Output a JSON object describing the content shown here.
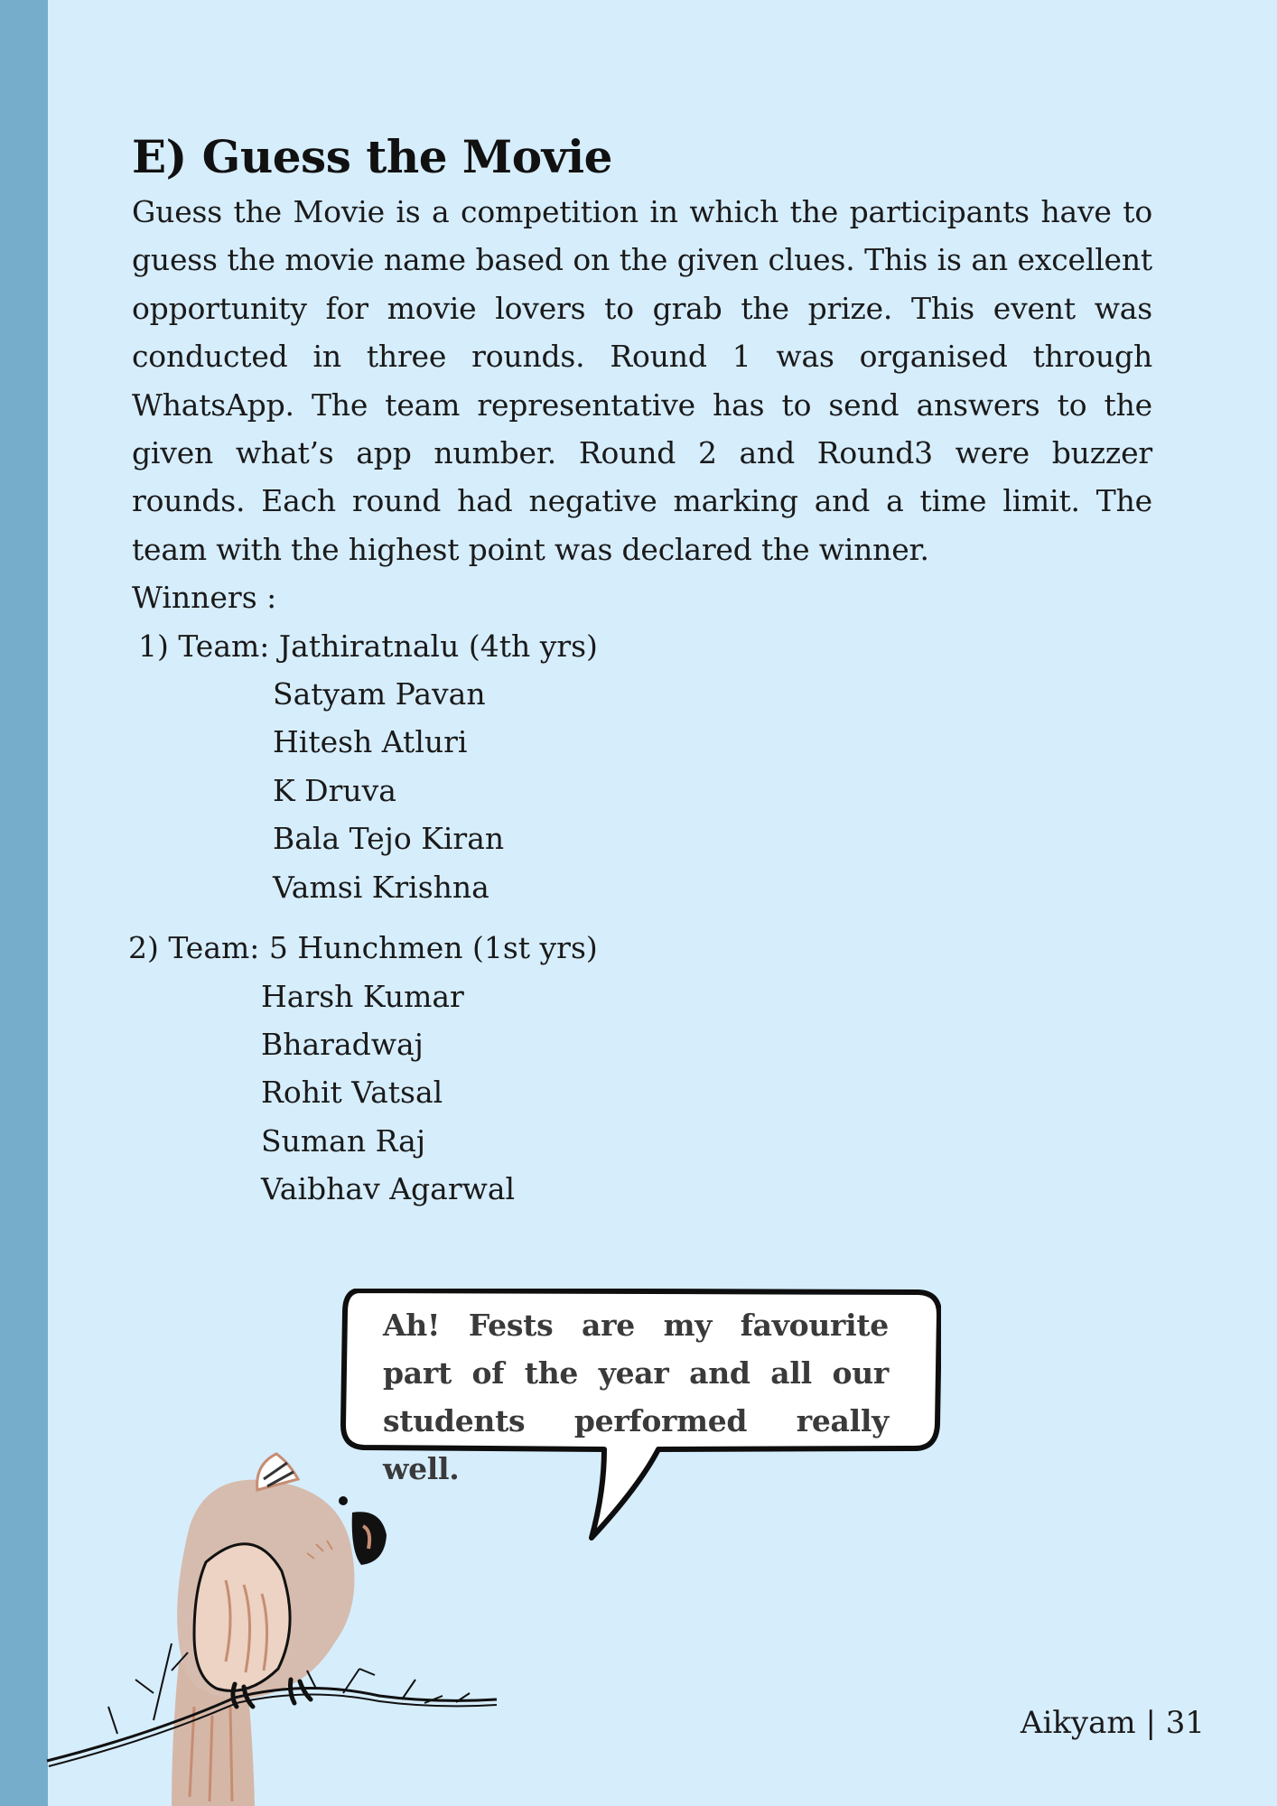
{
  "section": {
    "title": "E) Guess the Movie",
    "body": "Guess the Movie is a competition in which the participants have to guess the movie name based on the given clues. This is an excellent opportunity for movie lovers to grab the prize. This event was conducted in three rounds. Round 1 was organised through WhatsApp. The team representative has to send answers to the given what’s app number. Round 2 and Round3 were buzzer rounds. Each round had negative marking and a time limit. The team with the highest point was declared the winner.",
    "winners_label": "Winners :"
  },
  "teams": [
    {
      "heading": "1) Team: Jathiratnalu (4th yrs)",
      "members": [
        "Satyam Pavan",
        "Hitesh Atluri",
        "K Druva",
        "Bala Tejo Kiran",
        "Vamsi Krishna"
      ]
    },
    {
      "heading": "2) Team: 5 Hunchmen (1st yrs)",
      "members": [
        "Harsh Kumar",
        "Bharadwaj",
        "Rohit Vatsal",
        "Suman Raj",
        "Vaibhav Agarwal"
      ]
    }
  ],
  "speech_bubble": {
    "text": "Ah! Fests are my favourite part of the year and all our students performed really well."
  },
  "footer": {
    "magazine": "Aikyam",
    "separator": "|",
    "page_number": "31"
  },
  "colors": {
    "page_background": "#d6edfc",
    "side_bar": "#75adcb"
  },
  "illustration": {
    "icon": "cockatoo-on-branch-icon"
  }
}
